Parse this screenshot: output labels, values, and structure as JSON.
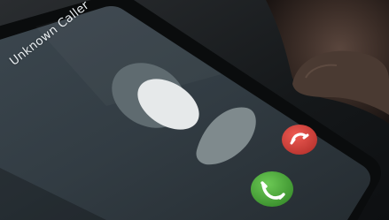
{
  "call_screen": {
    "caller_name": "Unknown Caller",
    "buttons": [
      {
        "name": "decline-call-button",
        "icon": "phone-hangup-icon",
        "color": "#d9463f"
      },
      {
        "name": "accept-call-button",
        "icon": "phone-icon",
        "color": "#4bae3b"
      }
    ]
  },
  "colors": {
    "screen_background": "#3a454d",
    "avatar_fill": "#e6e9ea",
    "avatar_shadow": "#5f6b70"
  }
}
